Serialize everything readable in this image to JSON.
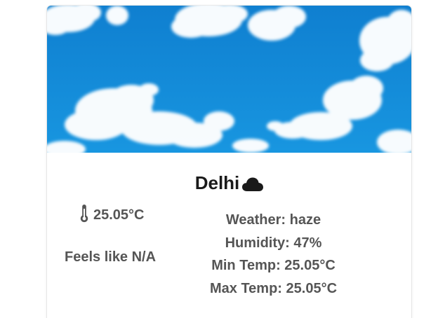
{
  "card": {
    "background_image": "sky-with-clouds",
    "city": "Delhi",
    "weather_icon": "cloud-icon",
    "temperature": "25.05°C",
    "temperature_icon": "thermometer-icon",
    "feels_like": "Feels like N/A",
    "details": {
      "weather": "Weather: haze",
      "humidity": "Humidity: 47%",
      "min_temp": "Min Temp: 25.05°C",
      "max_temp": "Max Temp: 25.05°C"
    }
  },
  "colors": {
    "sky": "#1389d6",
    "text_dark": "#1a1a1a",
    "text_muted": "#555555"
  }
}
